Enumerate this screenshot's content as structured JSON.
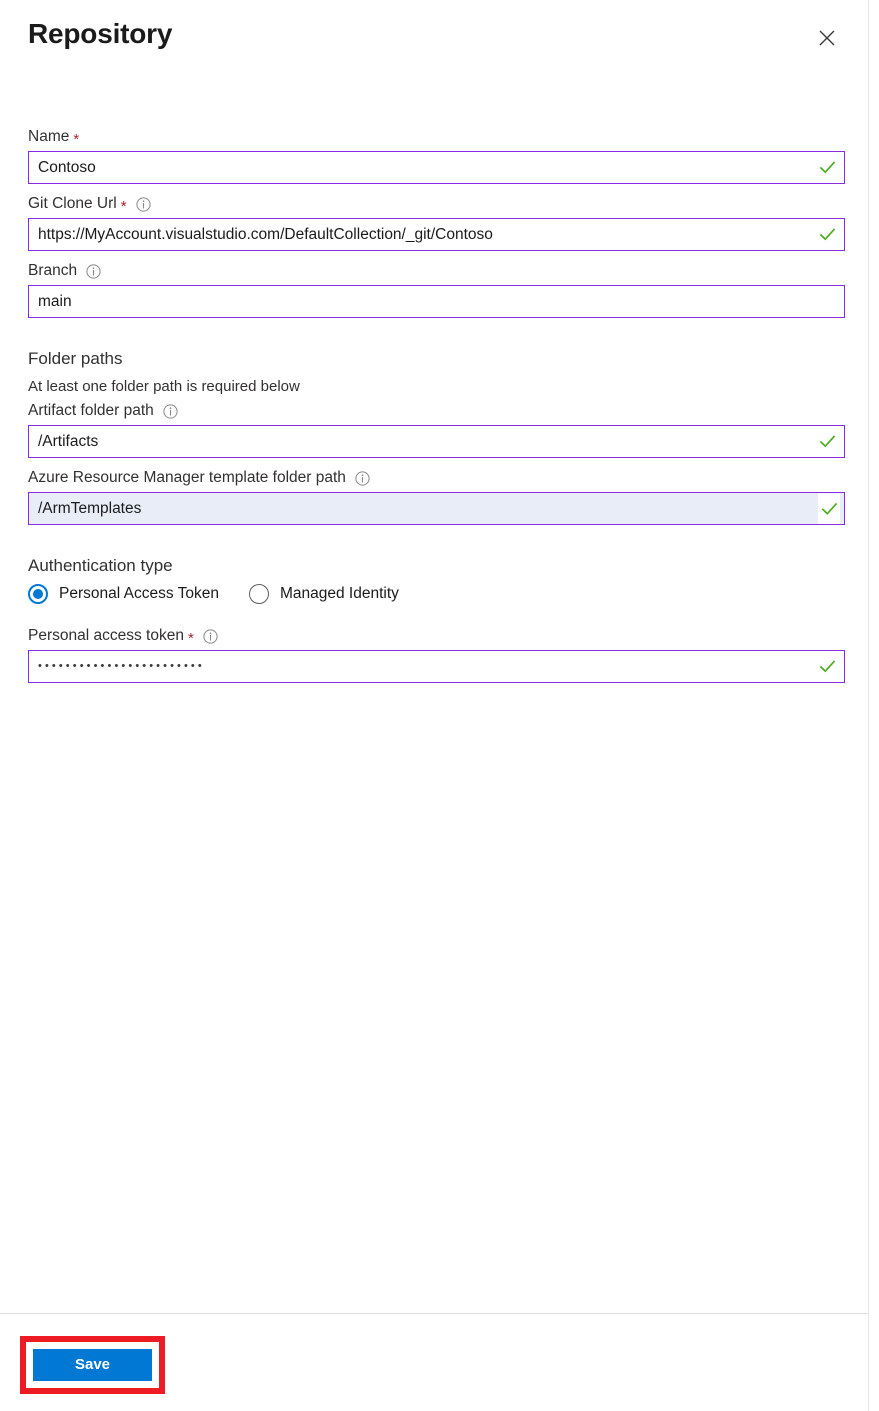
{
  "header": {
    "title": "Repository",
    "close_icon": "close-icon"
  },
  "fields": {
    "name": {
      "label": "Name",
      "required_marker": "*",
      "value": "Contoso",
      "valid": true
    },
    "git_clone_url": {
      "label": "Git Clone Url",
      "required_marker": "*",
      "info_icon": "info-icon",
      "value": "https://MyAccount.visualstudio.com/DefaultCollection/_git/Contoso",
      "valid": true
    },
    "branch": {
      "label": "Branch",
      "info_icon": "info-icon",
      "value": "main",
      "valid": false
    }
  },
  "folder_paths": {
    "heading": "Folder paths",
    "helper": "At least one folder path is required below",
    "artifact": {
      "label": "Artifact folder path",
      "info_icon": "info-icon",
      "value": "/Artifacts",
      "valid": true
    },
    "arm_template": {
      "label": "Azure Resource Manager template folder path",
      "info_icon": "info-icon",
      "value": "/ArmTemplates",
      "valid": true,
      "highlighted": true
    }
  },
  "authentication": {
    "heading": "Authentication type",
    "options": [
      {
        "label": "Personal Access Token",
        "selected": true
      },
      {
        "label": "Managed Identity",
        "selected": false
      }
    ],
    "token": {
      "label": "Personal access token",
      "required_marker": "*",
      "info_icon": "info-icon",
      "value": "••••••••••••••••••••••••",
      "valid": true
    }
  },
  "footer": {
    "save_label": "Save"
  },
  "colors": {
    "accent_blue": "#0078d4",
    "input_border_purple": "#8a2be2",
    "valid_check_green": "#4cac1e",
    "required_red": "#a4262c",
    "annotation_red": "#ed1c24",
    "highlight_bg": "#e9edf8"
  }
}
